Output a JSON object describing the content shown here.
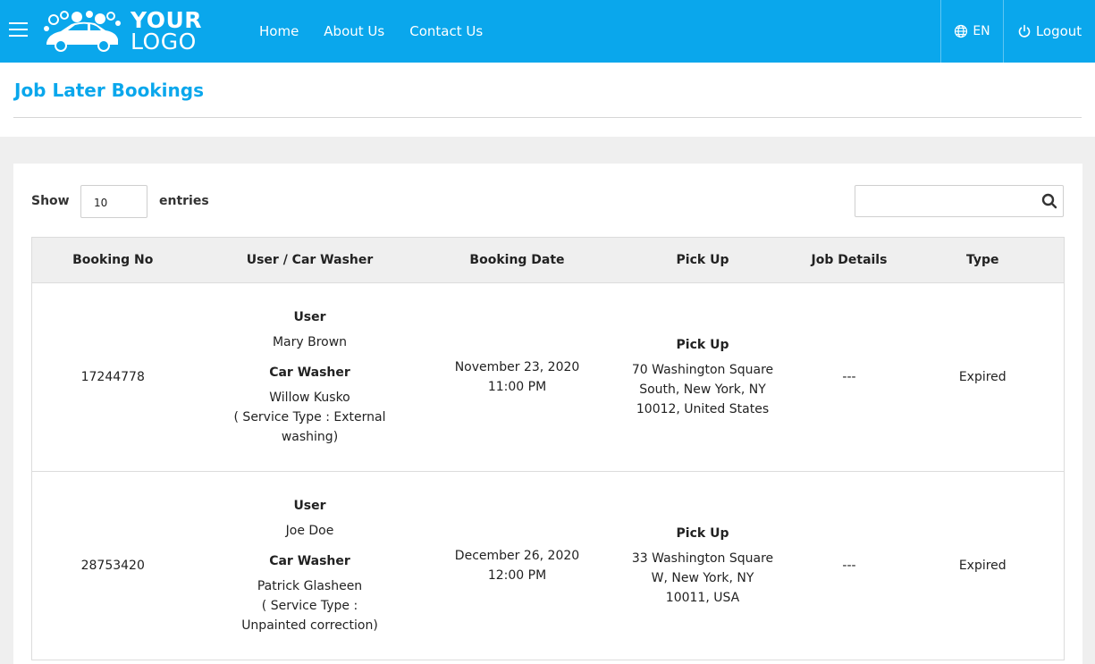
{
  "header": {
    "logo_line1": "YOUR",
    "logo_line2": "LOGO",
    "nav": [
      "Home",
      "About Us",
      "Contact Us"
    ],
    "language": "EN",
    "logout": "Logout",
    "brand_color": "#0aa7ec"
  },
  "page": {
    "title": "Job Later Bookings"
  },
  "controls": {
    "show_label": "Show",
    "entries_value": "10",
    "entries_label": "entries",
    "search_value": ""
  },
  "table": {
    "headers": [
      "Booking No",
      "User / Car Washer",
      "Booking Date",
      "Pick Up",
      "Job Details",
      "Type"
    ],
    "rows": [
      {
        "booking_no": "17244778",
        "user_label": "User",
        "user_name": "Mary Brown",
        "washer_label": "Car Washer",
        "washer_name": "Willow Kusko",
        "service_type": "( Service Type : External washing)",
        "date": "November 23, 2020",
        "time": "11:00 PM",
        "pickup_label": "Pick Up",
        "pickup_address": "70 Washington Square South, New York, NY 10012, United States",
        "job_details": "---",
        "type": "Expired"
      },
      {
        "booking_no": "28753420",
        "user_label": "User",
        "user_name": "Joe Doe",
        "washer_label": "Car Washer",
        "washer_name": "Patrick Glasheen",
        "service_type": "( Service Type : Unpainted correction)",
        "date": "December 26, 2020",
        "time": "12:00 PM",
        "pickup_label": "Pick Up",
        "pickup_address": "33 Washington Square W, New York, NY 10011, USA",
        "job_details": "---",
        "type": "Expired"
      }
    ]
  },
  "icons": {
    "menu": "hamburger-icon",
    "language": "globe-icon",
    "logout": "power-icon",
    "search": "search-icon",
    "logo": "car-wash-logo"
  }
}
